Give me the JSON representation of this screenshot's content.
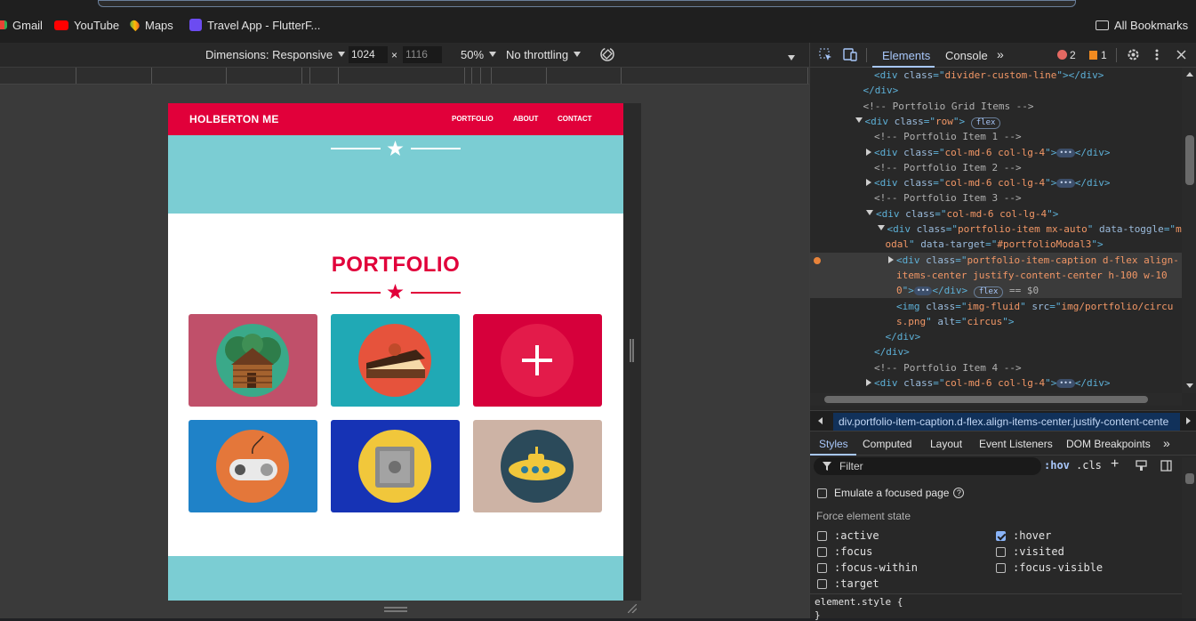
{
  "bookmarks": {
    "items": [
      "Gmail",
      "YouTube",
      "Maps",
      "Travel App - FlutterF..."
    ],
    "all_bookmarks": "All Bookmarks"
  },
  "device_toolbar": {
    "dimensions": "Dimensions: Responsive",
    "width": "1024",
    "times": "×",
    "height": "1116",
    "zoom": "50%",
    "throttling": "No throttling"
  },
  "site": {
    "brand": "HOLBERTON ME",
    "nav": [
      "PORTFOLIO",
      "ABOUT",
      "CONTACT"
    ],
    "section_title": "PORTFOLIO",
    "tiles": [
      {
        "name": "cabin",
        "bg": "#c0506a"
      },
      {
        "name": "cake",
        "bg": "#20a9b5"
      },
      {
        "name": "circus",
        "bg": "#d6003b"
      },
      {
        "name": "game",
        "bg": "#1f82c8"
      },
      {
        "name": "safe",
        "bg": "#1633b5"
      },
      {
        "name": "submarine",
        "bg": "#cdb3a5"
      }
    ]
  },
  "devtools": {
    "tabs": [
      "Elements",
      "Console"
    ],
    "errors": "2",
    "warnings": "1",
    "lines": [
      {
        "i": 6,
        "parts": [
          [
            "tag",
            "<div "
          ],
          [
            "attr",
            "class"
          ],
          [
            "tag",
            "=\""
          ],
          [
            "aval",
            "divider-custom-line"
          ],
          [
            "tag",
            "\"></div>"
          ]
        ]
      },
      {
        "i": 5,
        "parts": [
          [
            "tag",
            "</div>"
          ]
        ]
      },
      {
        "i": 5,
        "parts": [
          [
            "cmt",
            "<!-- Portfolio Grid Items -->"
          ]
        ]
      },
      {
        "i": 5,
        "tri": "down",
        "parts": [
          [
            "tag",
            "<div "
          ],
          [
            "attr",
            "class"
          ],
          [
            "tag",
            "=\""
          ],
          [
            "aval",
            "row"
          ],
          [
            "tag",
            "\">"
          ]
        ],
        "pill": "flex"
      },
      {
        "i": 6,
        "parts": [
          [
            "cmt",
            "<!-- Portfolio Item 1 -->"
          ]
        ]
      },
      {
        "i": 6,
        "tri": "right",
        "parts": [
          [
            "tag",
            "<div "
          ],
          [
            "attr",
            "class"
          ],
          [
            "tag",
            "=\""
          ],
          [
            "aval",
            "col-md-6 col-lg-4"
          ],
          [
            "tag",
            "\">"
          ]
        ],
        "dots": true,
        "after": "</div>"
      },
      {
        "i": 6,
        "parts": [
          [
            "cmt",
            "<!-- Portfolio Item 2 -->"
          ]
        ]
      },
      {
        "i": 6,
        "tri": "right",
        "parts": [
          [
            "tag",
            "<div "
          ],
          [
            "attr",
            "class"
          ],
          [
            "tag",
            "=\""
          ],
          [
            "aval",
            "col-md-6 col-lg-4"
          ],
          [
            "tag",
            "\">"
          ]
        ],
        "dots": true,
        "after": "</div>"
      },
      {
        "i": 6,
        "parts": [
          [
            "cmt",
            "<!-- Portfolio Item 3 -->"
          ]
        ]
      },
      {
        "i": 6,
        "tri": "down",
        "parts": [
          [
            "tag",
            "<div "
          ],
          [
            "attr",
            "class"
          ],
          [
            "tag",
            "=\""
          ],
          [
            "aval",
            "col-md-6 col-lg-4"
          ],
          [
            "tag",
            "\">"
          ]
        ]
      },
      {
        "i": 7,
        "tri": "down",
        "parts": [
          [
            "tag",
            "<div "
          ],
          [
            "attr",
            "class"
          ],
          [
            "tag",
            "=\""
          ],
          [
            "aval",
            "portfolio-item mx-auto"
          ],
          [
            "tag",
            "\" "
          ],
          [
            "attr",
            "data-toggle"
          ],
          [
            "tag",
            "=\""
          ],
          [
            "aval",
            "m"
          ]
        ]
      },
      {
        "i": 7,
        "parts": [
          [
            "aval",
            "odal"
          ],
          [
            "tag",
            "\" "
          ],
          [
            "attr",
            "data-target"
          ],
          [
            "tag",
            "=\""
          ],
          [
            "aval",
            "#portfolioModal3"
          ],
          [
            "tag",
            "\">"
          ]
        ]
      },
      {
        "i": 8,
        "tri": "right",
        "sel": true,
        "parts": [
          [
            "tag",
            "<div "
          ],
          [
            "attr",
            "class"
          ],
          [
            "tag",
            "=\""
          ],
          [
            "aval",
            "portfolio-item-caption d-flex align-"
          ]
        ]
      },
      {
        "i": 8,
        "sel": true,
        "parts": [
          [
            "aval",
            "items-center justify-content-center h-100 w-10"
          ]
        ]
      },
      {
        "i": 8,
        "sel": true,
        "parts": [
          [
            "aval",
            "0"
          ],
          [
            "tag",
            "\">"
          ]
        ],
        "dots": true,
        "after": "</div>",
        "pill": "flex",
        "eq": "== $0"
      },
      {
        "i": 8,
        "parts": [
          [
            "tag",
            "<img "
          ],
          [
            "attr",
            "class"
          ],
          [
            "tag",
            "=\""
          ],
          [
            "aval",
            "img-fluid"
          ],
          [
            "tag",
            "\" "
          ],
          [
            "attr",
            "src"
          ],
          [
            "tag",
            "=\""
          ],
          [
            "aval",
            "img/portfolio/circu"
          ]
        ]
      },
      {
        "i": 8,
        "parts": [
          [
            "aval",
            "s.png"
          ],
          [
            "tag",
            "\" "
          ],
          [
            "attr",
            "alt"
          ],
          [
            "tag",
            "=\""
          ],
          [
            "aval",
            "circus"
          ],
          [
            "tag",
            "\">"
          ]
        ]
      },
      {
        "i": 7,
        "parts": [
          [
            "tag",
            "</div>"
          ]
        ]
      },
      {
        "i": 6,
        "parts": [
          [
            "tag",
            "</div>"
          ]
        ]
      },
      {
        "i": 6,
        "parts": [
          [
            "cmt",
            "<!-- Portfolio Item 4 -->"
          ]
        ]
      },
      {
        "i": 6,
        "tri": "right",
        "parts": [
          [
            "tag",
            "<div "
          ],
          [
            "attr",
            "class"
          ],
          [
            "tag",
            "=\""
          ],
          [
            "aval",
            "col-md-6 col-lg-4"
          ],
          [
            "tag",
            "\">"
          ]
        ],
        "dots": true,
        "after": "</div>"
      },
      {
        "i": 6,
        "parts": [
          [
            "cmt",
            "<!-- Portfolio Item 5 -->"
          ]
        ]
      }
    ],
    "breadcrumb": "div.portfolio-item-caption.d-flex.align-items-center.justify-content-cente",
    "style_tabs": [
      "Styles",
      "Computed",
      "Layout",
      "Event Listeners",
      "DOM Breakpoints"
    ],
    "filter_placeholder": "Filter",
    "hov": ":hov",
    "cls": ".cls",
    "emulate_focus": "Emulate a focused page",
    "force_state": "Force element state",
    "states_left": [
      ":active",
      ":focus",
      ":focus-within",
      ":target"
    ],
    "states_right": [
      ":hover",
      ":visited",
      ":focus-visible"
    ],
    "checked_state": ":hover",
    "element_style": "element.style {",
    "closing_brace": "}"
  }
}
